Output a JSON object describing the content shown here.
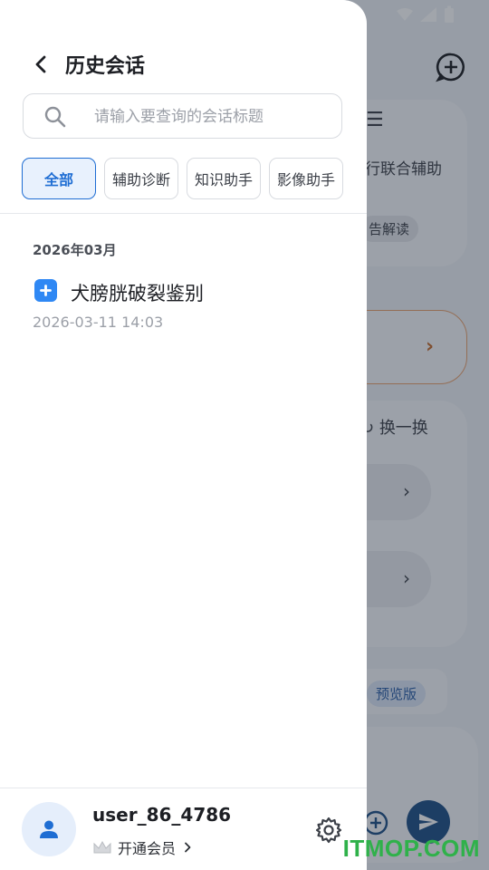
{
  "background": {
    "text_assist": "行联合辅助",
    "text_report": "告解读",
    "refresh": "换一换",
    "badge": "预览版"
  },
  "drawer": {
    "title": "历史会话",
    "search": {
      "placeholder": "请输入要查询的会话标题",
      "value": ""
    },
    "filters": [
      "全部",
      "辅助诊断",
      "知识助手",
      "影像助手"
    ],
    "active_filter": "全部",
    "groups": [
      {
        "label": "2026年03月",
        "sessions": [
          {
            "title": "犬膀胱破裂鉴别",
            "time": "2026-03-11 14:03"
          }
        ]
      }
    ]
  },
  "user": {
    "name": "user_86_4786",
    "membership_label": "开通会员"
  },
  "watermark": "ITMOP.COM",
  "icons": [
    "back-icon",
    "search-icon",
    "medical-kit-icon",
    "person-icon",
    "crown-icon",
    "chevron-right-icon",
    "gear-icon",
    "add-chat-icon",
    "send-icon"
  ],
  "colors": {
    "accent": "#1e6dd3",
    "session_icon": "#2f88f4",
    "send_button": "#1d4e86"
  }
}
